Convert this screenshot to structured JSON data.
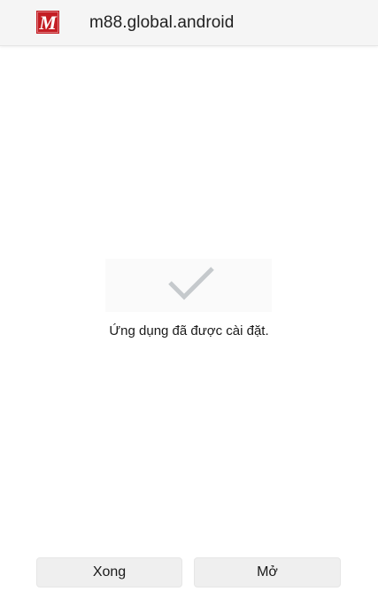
{
  "header": {
    "logo_icon": "m88-logo-icon",
    "logo_letter": "M",
    "package_name": "m88.global.android"
  },
  "status": {
    "icon": "checkmark-icon",
    "message": "Ứng dụng đã được cài đặt."
  },
  "actions": {
    "done_label": "Xong",
    "open_label": "Mở"
  },
  "colors": {
    "logo_red": "#c41e24",
    "check_gray": "#c5c9cc",
    "button_bg": "#efefef",
    "app_bar_bg": "#f5f5f5"
  }
}
